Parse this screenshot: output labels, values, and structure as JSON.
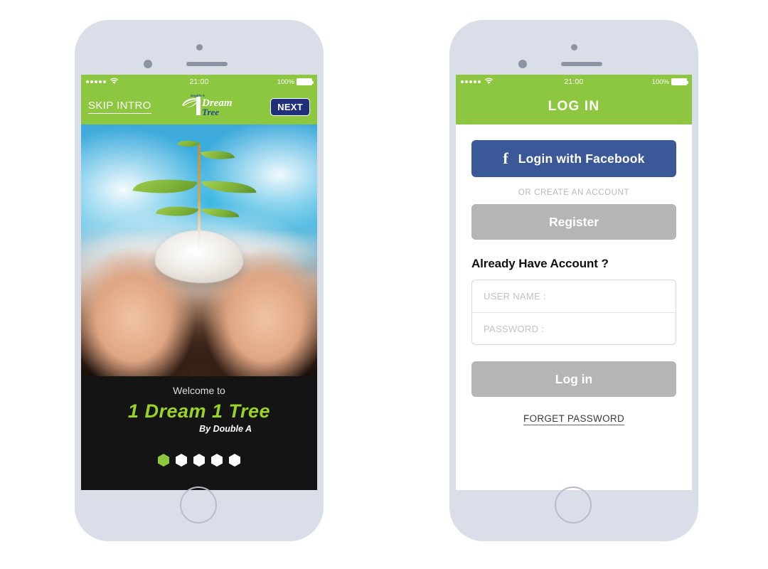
{
  "status_bar": {
    "signal_dots": 5,
    "wifi_icon": "wifi-icon",
    "time": "21:00",
    "battery_percent": "100%"
  },
  "intro_screen": {
    "header": {
      "skip_label": "SKIP INTRO",
      "next_label": "NEXT",
      "logo": {
        "brand_top": "Double A",
        "numeral": "1",
        "line1": "Dream",
        "line2": "Tree"
      }
    },
    "hero": {
      "alt": "seedling growing from crumpled paper held in cupped hands against a blue sky"
    },
    "footer": {
      "welcome": "Welcome to",
      "title": "1 Dream 1 Tree",
      "by": "By  Double A",
      "pagination": {
        "total": 5,
        "active_index": 0
      }
    }
  },
  "login_screen": {
    "title": "LOG IN",
    "facebook_button": "Login with Facebook",
    "facebook_icon": "facebook-f-icon",
    "or_create": "OR CREATE AN ACCOUNT",
    "register_button": "Register",
    "already_heading": "Already Have Account ?",
    "username": {
      "value": "",
      "placeholder": "USER NAME :"
    },
    "password": {
      "value": "",
      "placeholder": "PASSWORD :"
    },
    "login_button": "Log in",
    "forget_password": "FORGET PASSWORD"
  },
  "colors": {
    "green": "#8dc63f",
    "navy": "#1f2f7a",
    "facebook_blue": "#3b5998",
    "gray_button": "#b5b5b5",
    "title_green": "#9ad327",
    "frame": "#dadee8",
    "dark_panel": "#141414"
  }
}
